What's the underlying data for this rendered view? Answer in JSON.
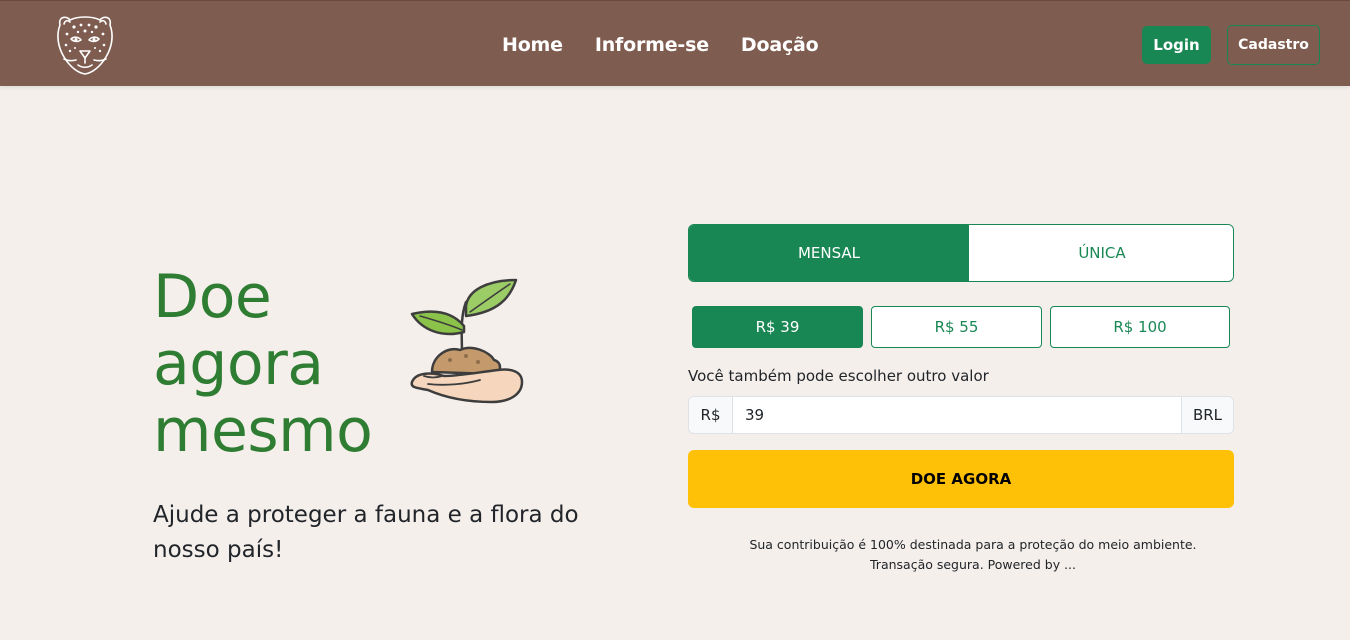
{
  "nav": {
    "logo_icon": "jaguar-head-icon",
    "links": [
      "Home",
      "Informe-se",
      "Doação"
    ],
    "login_label": "Login",
    "signup_label": "Cadastro"
  },
  "hero": {
    "title_lines": [
      "Doe",
      "agora",
      "mesmo"
    ],
    "subtitle": "Ajude a proteger a fauna e a flora do nosso país!",
    "illustration_icon": "plant-in-hand-icon"
  },
  "donation": {
    "frequency_tabs": [
      "MENSAL",
      "ÚNICA"
    ],
    "selected_frequency": "MENSAL",
    "amounts": [
      "R$ 39",
      "R$ 55",
      "R$ 100"
    ],
    "selected_amount": "R$ 39",
    "other_amount_label": "Você também pode escolher outro valor",
    "currency_prefix": "R$",
    "amount_value": "39",
    "currency_suffix": "BRL",
    "cta_label": "DOE AGORA",
    "footnote_line1": "Sua contribuição é 100% destinada para a proteção do meio ambiente.",
    "footnote_line2": "Transação segura. Powered by ..."
  },
  "colors": {
    "navbar": "#7f5c50",
    "primary_green": "#198754",
    "title_green": "#2e7d32",
    "cta_yellow": "#ffc107",
    "background": "#f5efec"
  }
}
